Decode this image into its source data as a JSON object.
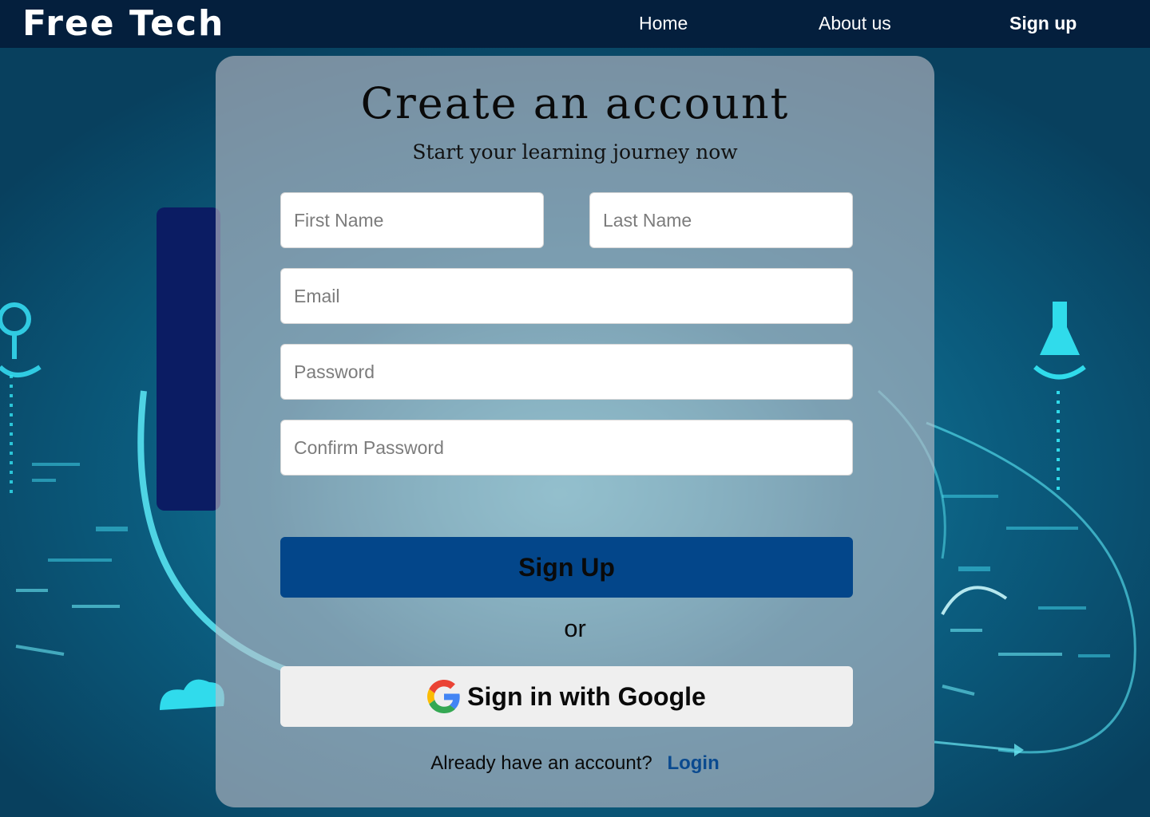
{
  "nav": {
    "logo": "Free Tech",
    "links": [
      "Home",
      "About us",
      "Sign up"
    ]
  },
  "form": {
    "title": "Create an account",
    "subtitle": "Start your learning journey now",
    "first_name_placeholder": "First Name",
    "last_name_placeholder": "Last Name",
    "email_placeholder": "Email",
    "password_placeholder": "Password",
    "confirm_password_placeholder": "Confirm Password",
    "signup_label": "Sign Up",
    "or_label": "or",
    "google_label": "Sign in with Google",
    "footer_text": "Already have an account?",
    "login_label": "Login"
  },
  "colors": {
    "navbar": "#041f3d",
    "primary_button": "#03468a",
    "login_link": "#0a4a8f",
    "google_button": "#efefef",
    "card_overlay": "rgba(190,190,200,0.62)"
  },
  "icons": {
    "google": "google-g-icon"
  }
}
